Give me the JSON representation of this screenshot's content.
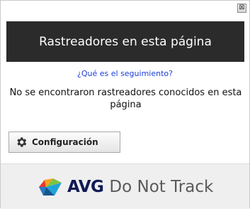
{
  "window": {
    "close_glyph": "⊠"
  },
  "header": {
    "title": "Rastreadores en esta página"
  },
  "content": {
    "link_text": "¿Qué es el seguimiento?",
    "message": "No se encontraron rastreadores conocidos en esta página"
  },
  "actions": {
    "config_label": "Configuración",
    "config_icon": "gear-icon"
  },
  "footer": {
    "brand": "AVG",
    "product": "Do Not Track",
    "logo_icon": "avg-logo-icon"
  },
  "colors": {
    "header_bg": "#2b2b2b",
    "link": "#1a3fd6",
    "brand_text": "#101a55",
    "footer_bg": "#efefef"
  }
}
